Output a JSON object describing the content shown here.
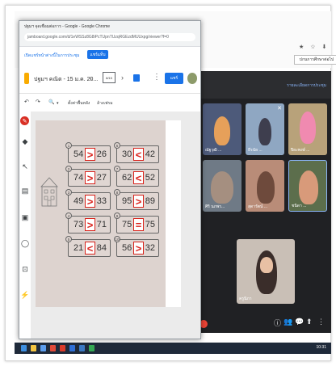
{
  "background_window": {
    "button_label": "ปกนการศึกษาต่อไป",
    "icons": "★ ☆ ⬇"
  },
  "popup": {
    "window_title": "ปฐมฯ จุดเชื่อมต่อการ - Google - Google Chrome",
    "url": "jamboard.google.com/d/1eWSSz8G8iPcTUpnTUzqRGEzdMUUxpg/viewer?f=0",
    "share_hint": "เปิดแชร์หน้าต่างนี้ในการประชุม",
    "share_button": "แชร์แท็บ",
    "app": {
      "doc_title": "ปฐมฯ คณิต - 15 ม.ค. 20...",
      "prev": "‹",
      "frame_label": "8/15",
      "next": "›",
      "more": "⋮",
      "share_button": "แชร์"
    },
    "toolbar": {
      "undo": "↶",
      "redo": "↷",
      "zoom": "🔍",
      "zoom_caret": "▾",
      "set_background": "ตั้งค่าพื้นหลัง",
      "clear_frame": "ล้างเฟรม"
    },
    "tools": {
      "pen": "✎",
      "eraser": "◆",
      "select": "↖",
      "sticky_note": "▤",
      "image": "▣",
      "circle": "◯",
      "text_box": "⊡",
      "laser": "⚡"
    }
  },
  "worksheet": {
    "items": [
      {
        "num": "1",
        "left": "54",
        "sign": ">",
        "right": "26"
      },
      {
        "num": "6",
        "left": "30",
        "sign": "<",
        "right": "42"
      },
      {
        "num": "2",
        "left": "74",
        "sign": ">",
        "right": "27"
      },
      {
        "num": "7",
        "left": "62",
        "sign": "<",
        "right": "52"
      },
      {
        "num": "3",
        "left": "49",
        "sign": ">",
        "right": "33"
      },
      {
        "num": "8",
        "left": "95",
        "sign": ">",
        "right": "89"
      },
      {
        "num": "4",
        "left": "73",
        "sign": ">",
        "right": "71"
      },
      {
        "num": "9",
        "left": "75",
        "sign": "=",
        "right": "75"
      },
      {
        "num": "5",
        "left": "21",
        "sign": "<",
        "right": "84"
      },
      {
        "num": "10",
        "left": "56",
        "sign": ">",
        "right": "32"
      }
    ]
  },
  "meet": {
    "link_text": "รายละเอียดการประชุม",
    "participants": [
      {
        "name": "ณัฐวุฒิ ...",
        "tile_color": "#4d5a7a"
      },
      {
        "name": "ธีรนัย ...",
        "tile_color": "#8fa7c2"
      },
      {
        "name": "ปิยะพงษ์ ...",
        "tile_color": "#b8a27a"
      },
      {
        "name": "ศิริ นภพร...",
        "tile_color": "#6f7a86"
      },
      {
        "name": "สุดารัตน์ ...",
        "tile_color": "#b98c78"
      },
      {
        "name": "ชนิดา ...",
        "tile_color": "#5c6e4c"
      },
      {
        "name": "ครูนิภา",
        "tile_color": "#c9bfb6"
      }
    ],
    "controls": {
      "end_call": "",
      "mic": "🎤",
      "camera": "▭",
      "present": "⬆",
      "more": "⋮",
      "info": "ⓘ",
      "people": "👥",
      "chat": "💬"
    }
  },
  "taskbar": {
    "time": "10:31"
  }
}
